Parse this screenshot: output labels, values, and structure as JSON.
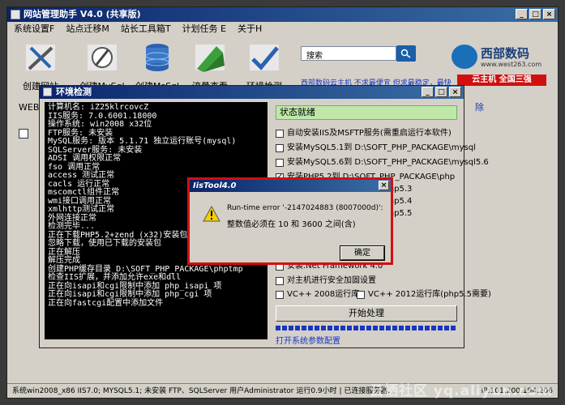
{
  "app": {
    "title": "网站管理助手 V4.0 (共享版)",
    "menu": [
      "系统设置F",
      "站点迁移M",
      "站长工具箱T",
      "计划任务 E",
      "关于H"
    ],
    "tools": [
      "创建网站",
      "创建MySql",
      "创建MsSql",
      "流量查看",
      "环境检测"
    ],
    "search_placeholder": "搜索",
    "brand_name": "西部数码",
    "brand_url": "www.west263.com",
    "ad_link": "西部数码云主机 不求最便宜 但求最稳定，最快",
    "ad_red": "云主机 全国三强",
    "web_field_label": "WEB网",
    "stray_right": "除",
    "statusbar_left": "系统win2008_x86 IIS7.0; MYSQL5.1; 未安装 FTP、SQLServer 用户Administrator 运行0.9小时 | 已连接服务器.",
    "statusbar_right": "IP:101.200.194.206",
    "watermark": "云栖社区 yq.aliyun.com"
  },
  "env_window": {
    "title": "环境检测",
    "console": [
      "计算机名: iZ25klrcovcZ",
      "IIS服务: 7.0.6001.18000",
      "操作系统: win2008 x32位",
      "FTP服务: 未安装",
      "MySQL服务: 版本 5.1.71 独立运行账号(mysql)",
      "SQLServer服务: 未安装",
      "ADSI 调用权限正常",
      "fso 调用正常",
      "access 测试正常",
      "cacls 运行正常",
      "mscomctl组件正常",
      "wmi接口调用正常",
      "xmlhttp测试正常",
      "外网连接正常",
      "检测完毕...",
      "正在下载PHP5.2+zend (x32)安装包",
      "忽略下载，使用已下载的安装包",
      "正在解压",
      "解压完成",
      "创建PHP缓存目录 D:\\SOFT_PHP_PACKAGE\\phptmp",
      "检查IIS扩展，并添加允许exe和dll",
      "正在向isapi和cgi限制中添加 php_isapi 项",
      "正在向isapi和cgi限制中添加 php_cgi 项",
      "正在向fastcgi配置中添加文件"
    ],
    "status": "状态就绪",
    "options": [
      {
        "label": "自动安装IIS及MSFTP服务(需重启运行本软件)",
        "checked": false
      },
      {
        "label": "安装MySQL5.1到 D:\\SOFT_PHP_PACKAGE\\mysql",
        "checked": false
      },
      {
        "label": "安装MySQL5.6到 D:\\SOFT_PHP_PACKAGE\\mysql5.6",
        "checked": false
      },
      {
        "label": "安装PHP5.2到 D:\\SOFT_PHP_PACKAGE\\php",
        "checked": true
      },
      {
        "label": "D:\\SOFT_PHP_PACKAGE\\php5.3",
        "checked": false
      },
      {
        "label": "D:\\SOFT_PHP_PACKAGE\\php5.4",
        "checked": false
      },
      {
        "label": "D:\\SOFT_PHP_PACKAGE\\php5.5",
        "checked": false
      },
      {
        "label": "安装.Net Framework 4.0",
        "checked": false
      },
      {
        "label": "对主机进行安全加固设置",
        "checked": false
      }
    ],
    "vc2008": "VC++ 2008运行库",
    "vc2012": "VC++ 2012运行库(php5.5需要)",
    "start_button": "开始处理",
    "params_link": "打开系统参数配置"
  },
  "dialog": {
    "title": "IisTool4.0",
    "message1": "Run-time error '-2147024883 (8007000d)':",
    "message2": "整数值必须在 10 和 3600 之间(含)",
    "ok_label": "确定"
  },
  "colors": {
    "titlebar": "#0a246a",
    "dialog_border": "#d01010",
    "status_green": "#bfe8a8",
    "link_blue": "#1a35c0"
  }
}
